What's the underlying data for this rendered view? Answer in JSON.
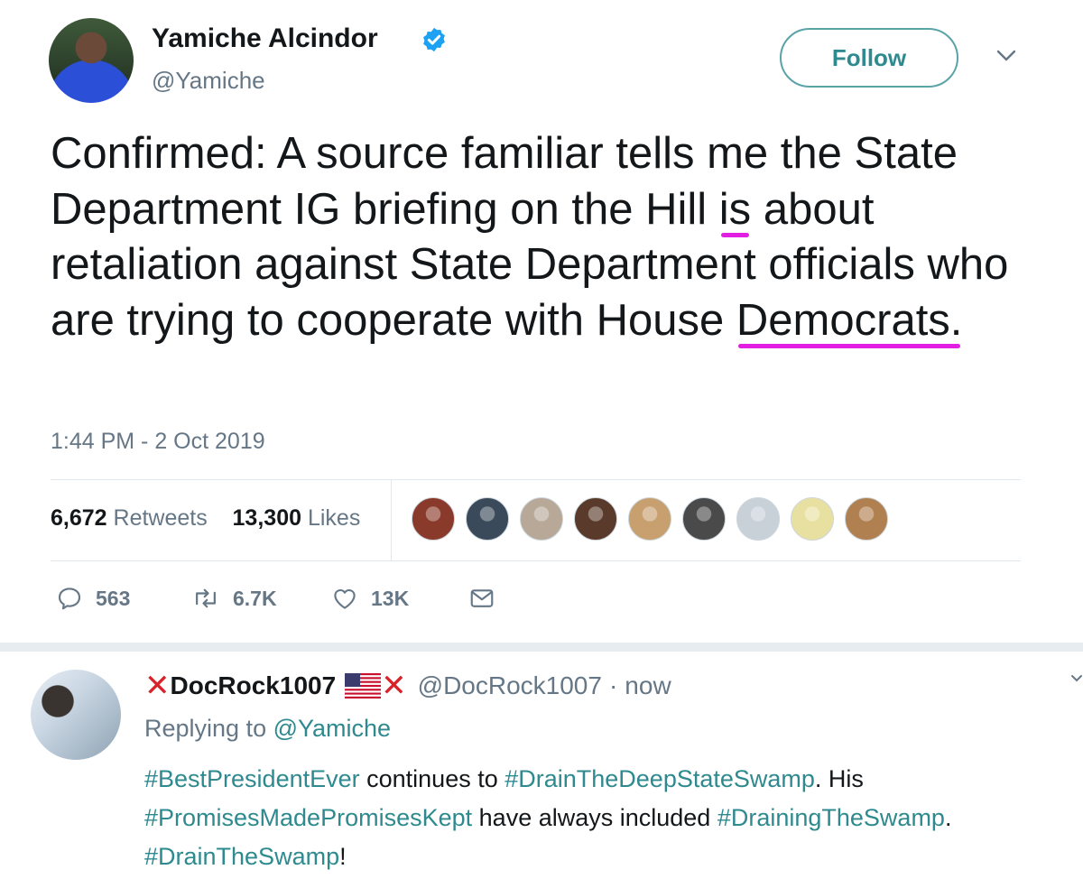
{
  "tweet": {
    "author_name": "Yamiche Alcindor",
    "author_handle": "@Yamiche",
    "follow_label": "Follow",
    "text_parts": [
      {
        "t": "Confirmed: A source familiar tells me the ",
        "hl": false
      },
      {
        "t": "State Department IG briefing",
        "hl": true
      },
      {
        "t": " on the Hill ",
        "hl": false
      },
      {
        "t": "is",
        "hl": true
      },
      {
        "t": " ",
        "hl": false
      },
      {
        "t": "about retaliation against State",
        "hl": true
      },
      {
        "t": " Department officials who are trying to cooperate with House ",
        "hl": false
      },
      {
        "t": "Democrats.",
        "hl": true
      }
    ],
    "timestamp": "1:44 PM - 2 Oct 2019",
    "retweets_count": "6,672",
    "retweets_label": "Retweets",
    "likes_count": "13,300",
    "likes_label": "Likes",
    "actions": {
      "replies": "563",
      "retweets": "6.7K",
      "likes": "13K"
    },
    "liker_avatar_colors": [
      "#8a3a2a",
      "#3a4a5a",
      "#b8a898",
      "#5a3a2a",
      "#c8a070",
      "#4a4a4a",
      "#c8d0d8",
      "#e8e0a0",
      "#b08050"
    ]
  },
  "reply": {
    "name": "DocRock1007",
    "handle": "@DocRock1007",
    "time": "now",
    "replying_prefix": "Replying to ",
    "replying_handle": "@Yamiche",
    "text_parts": [
      {
        "t": "#BestPresidentEver",
        "tag": true
      },
      {
        "t": " continues to ",
        "tag": false
      },
      {
        "t": "#DrainTheDeepStateSwamp",
        "tag": true
      },
      {
        "t": ". His ",
        "tag": false
      },
      {
        "t": "#PromisesMadePromisesKept",
        "tag": true
      },
      {
        "t": " have always included ",
        "tag": false
      },
      {
        "t": "#DrainingTheSwamp",
        "tag": true
      },
      {
        "t": ". ",
        "tag": false
      },
      {
        "t": "#DrainTheSwamp",
        "tag": true
      },
      {
        "t": "!",
        "tag": false
      }
    ]
  },
  "colors": {
    "highlight": "#e21ee2",
    "link": "#2e8a8f",
    "muted": "#657786",
    "xmark": "#d8232a"
  }
}
